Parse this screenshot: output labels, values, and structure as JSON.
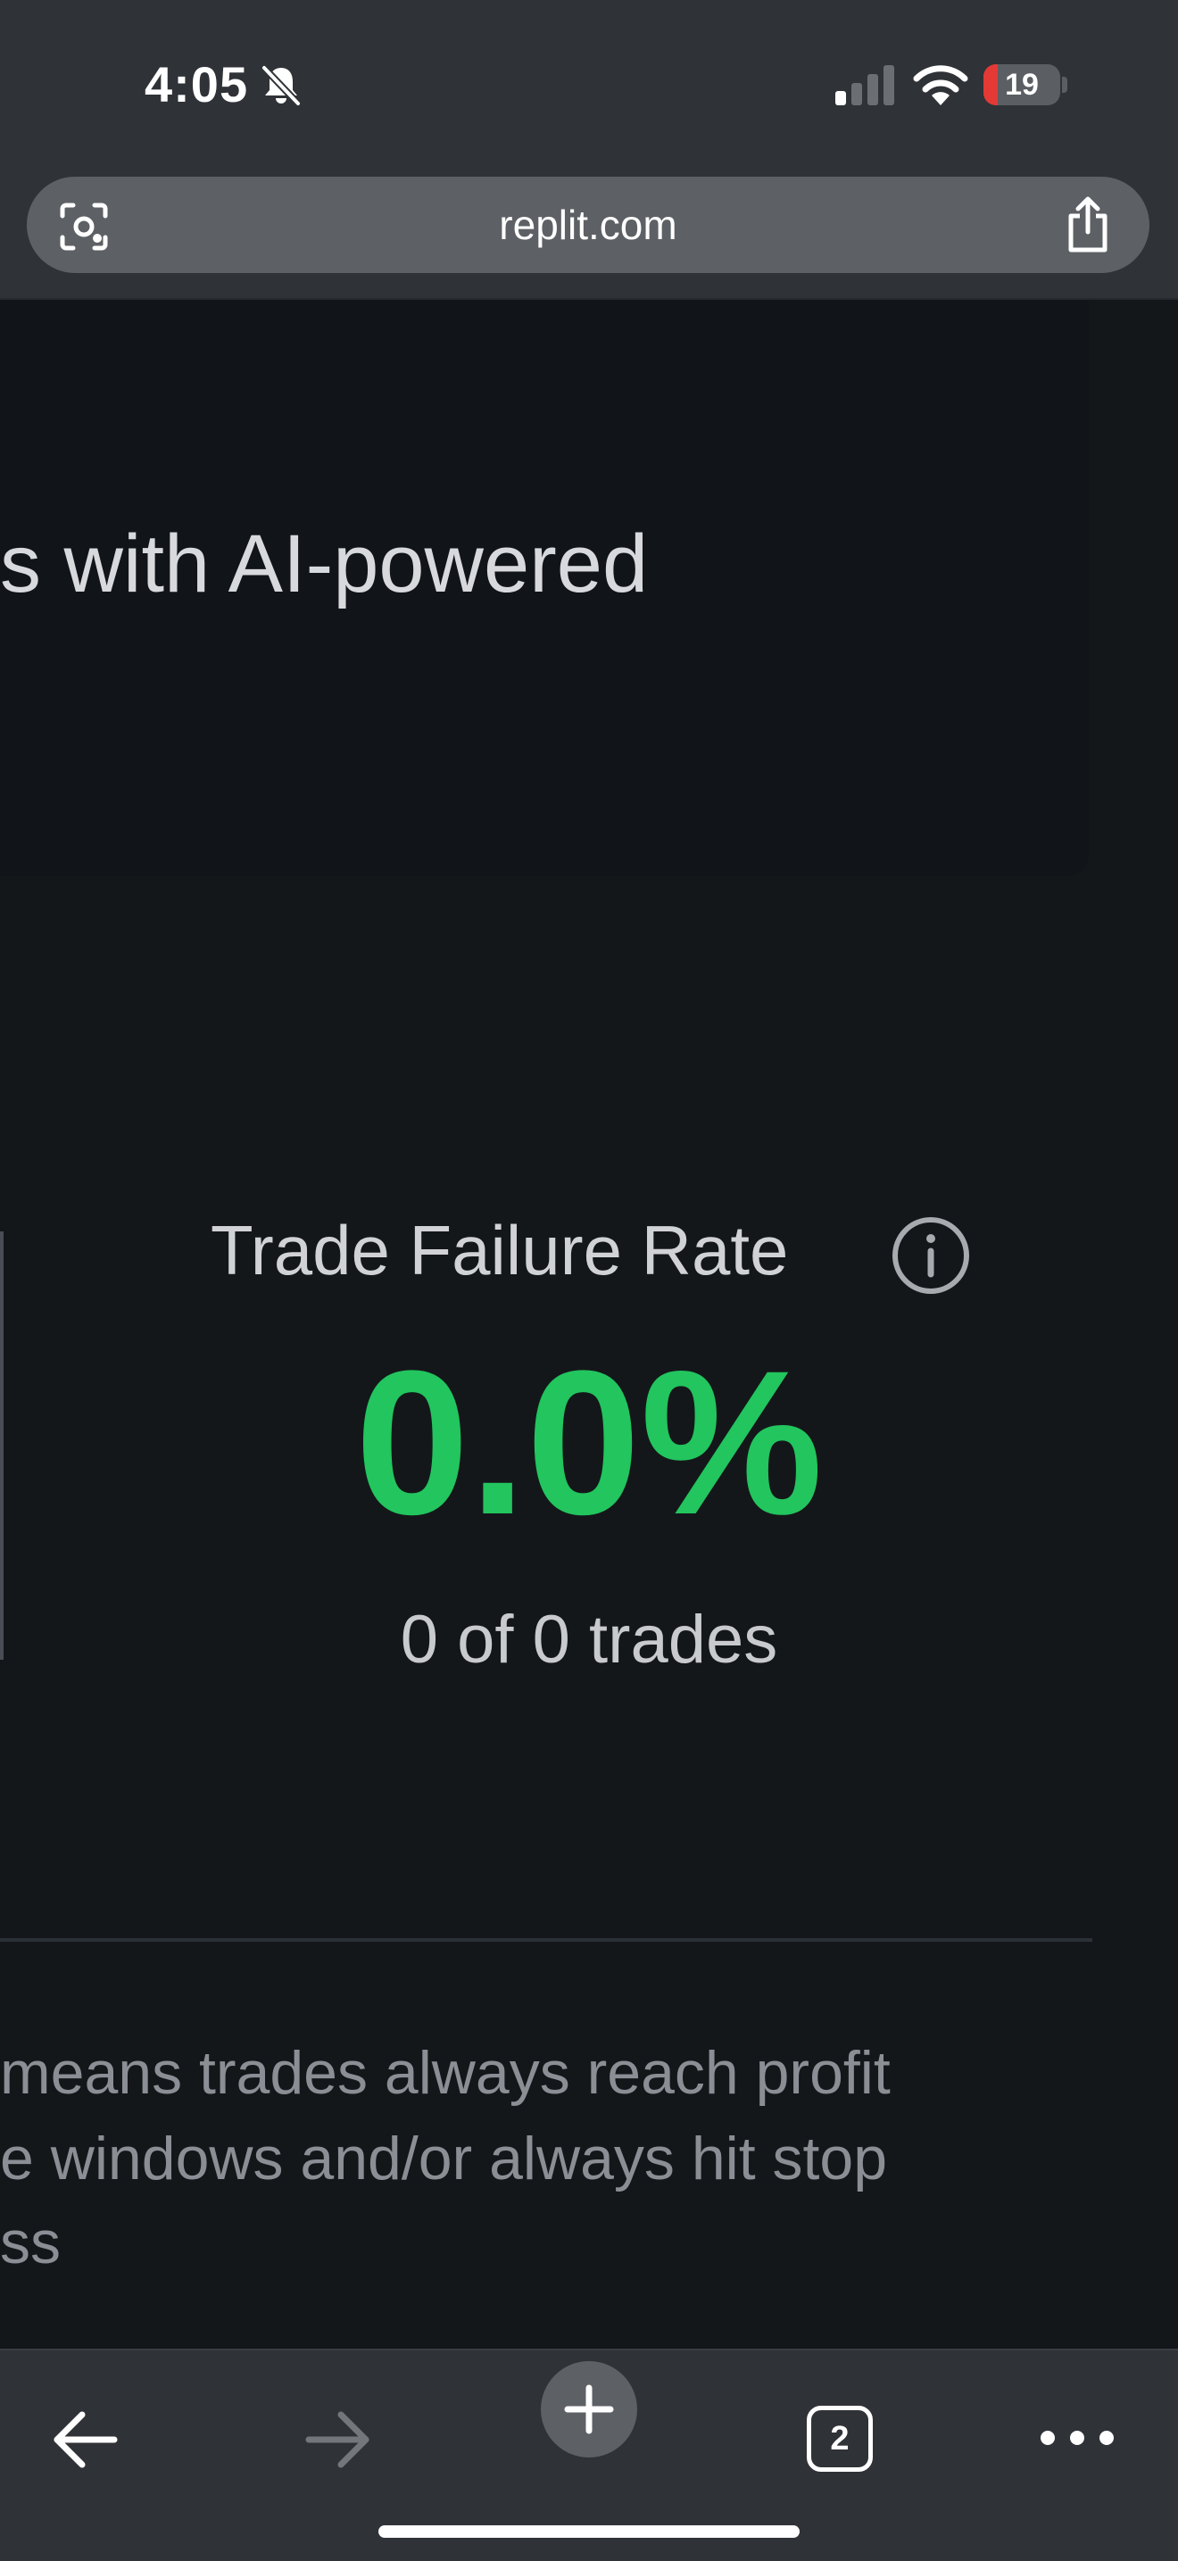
{
  "status_bar": {
    "time": "4:05",
    "battery": {
      "label": "19",
      "level": 0.19
    }
  },
  "browser": {
    "url": "replit.com"
  },
  "hero": {
    "text": "s with AI-powered"
  },
  "metric": {
    "title": "Trade Failure Rate",
    "value": "0.0%",
    "subtitle": "0 of 0 trades",
    "value_color": "#22c55e"
  },
  "note": {
    "lines": [
      "means trades always reach profit",
      "e windows and/or always hit stop",
      "ss"
    ]
  },
  "toolbar": {
    "tab_count": "2"
  },
  "icons": {
    "status": [
      "bell-slash-icon",
      "signal-icon",
      "wifi-icon"
    ],
    "url_bar": [
      "lens-icon",
      "share-icon"
    ],
    "toolbar": [
      "back-arrow-icon",
      "forward-arrow-icon",
      "plus-icon",
      "tabs-icon",
      "more-icon"
    ],
    "content": [
      "info-icon"
    ]
  }
}
